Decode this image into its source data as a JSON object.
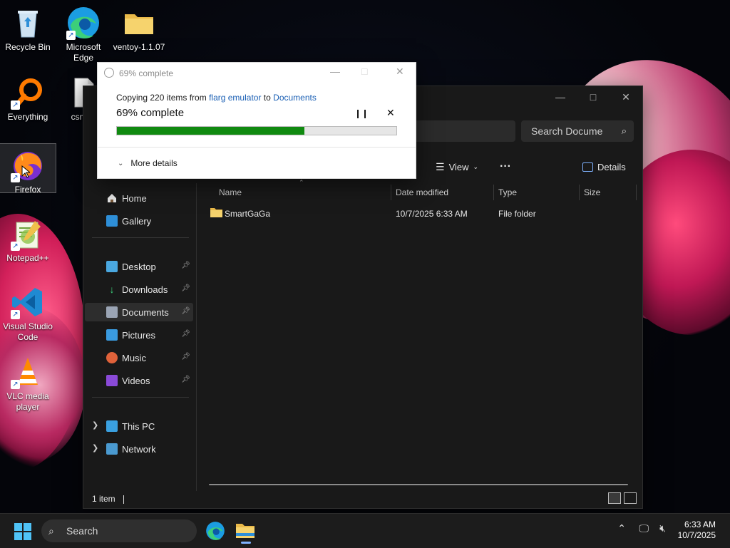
{
  "desktop": {
    "icons": [
      {
        "label": "Recycle Bin"
      },
      {
        "label": "Microsoft Edge"
      },
      {
        "label": "ventoy-1.1.07"
      },
      {
        "label": "Everything"
      },
      {
        "label": "csmwr"
      },
      {
        "label": "Firefox"
      },
      {
        "label": "Notepad++"
      },
      {
        "label": "Visual Studio Code"
      },
      {
        "label": "VLC media player"
      }
    ]
  },
  "explorer": {
    "search_placeholder": "Search Docume",
    "toolbar": {
      "view_label": "View",
      "more_label": "···",
      "details_label": "Details"
    },
    "nav": {
      "items": [
        {
          "label": "Home"
        },
        {
          "label": "Gallery"
        },
        {
          "label": "Desktop"
        },
        {
          "label": "Downloads"
        },
        {
          "label": "Documents"
        },
        {
          "label": "Pictures"
        },
        {
          "label": "Music"
        },
        {
          "label": "Videos"
        },
        {
          "label": "This PC"
        },
        {
          "label": "Network"
        }
      ],
      "active": "Documents"
    },
    "columns": [
      "Name",
      "Date modified",
      "Type",
      "Size"
    ],
    "rows": [
      {
        "name": "SmartGaGa",
        "date": "10/7/2025 6:33 AM",
        "type": "File folder",
        "size": ""
      }
    ],
    "status": "1 item"
  },
  "dialog": {
    "title": "69% complete",
    "line_prefix": "Copying 220 items from",
    "source": "flarg emulator",
    "line_mid": "to",
    "destination": "Documents",
    "percent_label": "69% complete",
    "progress": 0.67,
    "more_details": "More details"
  },
  "taskbar": {
    "search_label": "Search",
    "time": "6:33 AM",
    "date": "10/7/2025"
  },
  "colors": {
    "progress_green": "#108a10",
    "link_blue": "#1a5fb4",
    "explorer_bg": "#191919"
  }
}
